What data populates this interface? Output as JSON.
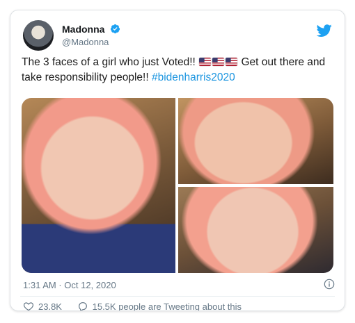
{
  "tweet": {
    "display_name": "Madonna",
    "handle": "@Madonna",
    "text_before": "The 3 faces of a girl who just Voted!!",
    "text_after": "Get out there and take responsibility people!!",
    "hashtag": "#bidenharris2020",
    "timestamp": "1:31 AM · Oct 12, 2020",
    "likes": "23.8K",
    "replies_text": "15.5K people are Tweeting about this",
    "flag_count": 3
  },
  "colors": {
    "link": "#1b95e0",
    "twitter_blue": "#1da1f2",
    "muted": "#657786"
  },
  "icons": {
    "verified": "verified-badge-icon",
    "bird": "twitter-bird-icon",
    "info": "info-icon",
    "heart": "heart-icon",
    "comment": "comment-icon"
  }
}
